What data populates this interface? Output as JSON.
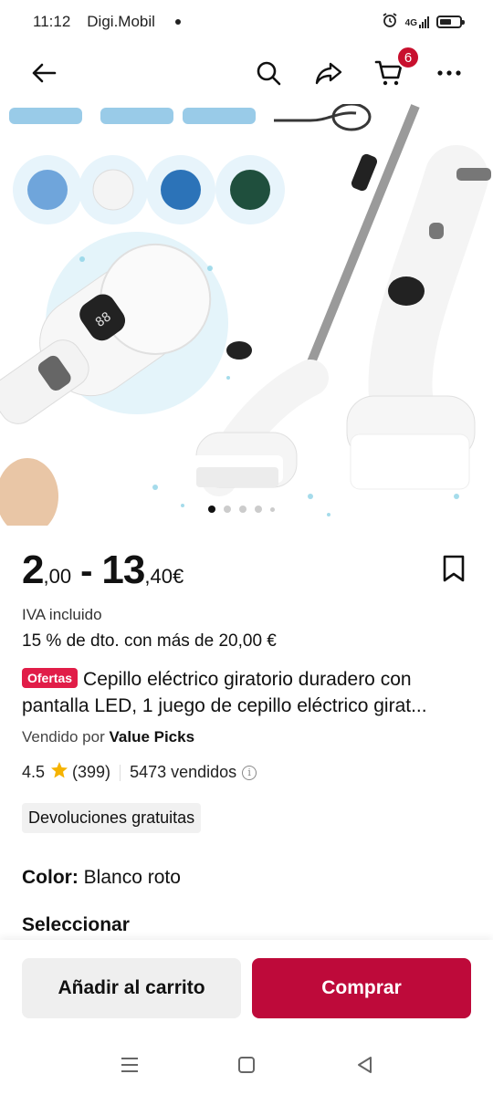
{
  "status_bar": {
    "time": "11:12",
    "carrier": "Digi.Mobil",
    "network": "4G",
    "battery_level": 0.6
  },
  "nav": {
    "icons": [
      "back-arrow-icon",
      "search-icon",
      "share-icon",
      "cart-icon",
      "more-icon"
    ],
    "cart_count": "6"
  },
  "gallery": {
    "image_count": 5,
    "active_index": 0
  },
  "product": {
    "price_from_int": "2",
    "price_from_dec": ",00",
    "price_separator": "-",
    "price_to_int": "13",
    "price_to_dec": ",40€",
    "tax_note": "IVA incluido",
    "discount_note": "15 % de dto. con más de 20,00 €",
    "badge": "Ofertas",
    "title": "Cepillo eléctrico giratorio duradero con pantalla LED, 1 juego de cepillo eléctrico girat...",
    "seller_prefix": "Vendido por",
    "seller_name": "Value Picks",
    "rating": "4.5",
    "reviews": "(399)",
    "sold": "5473 vendidos",
    "returns_label": "Devoluciones gratuitas",
    "color_label": "Color:",
    "color_value": "Blanco roto",
    "select_label": "Seleccionar"
  },
  "actions": {
    "add_to_cart": "Añadir al carrito",
    "buy": "Comprar"
  },
  "colors": {
    "accent": "#be0a3a",
    "badge": "#e11d48",
    "star": "#f5b301"
  }
}
